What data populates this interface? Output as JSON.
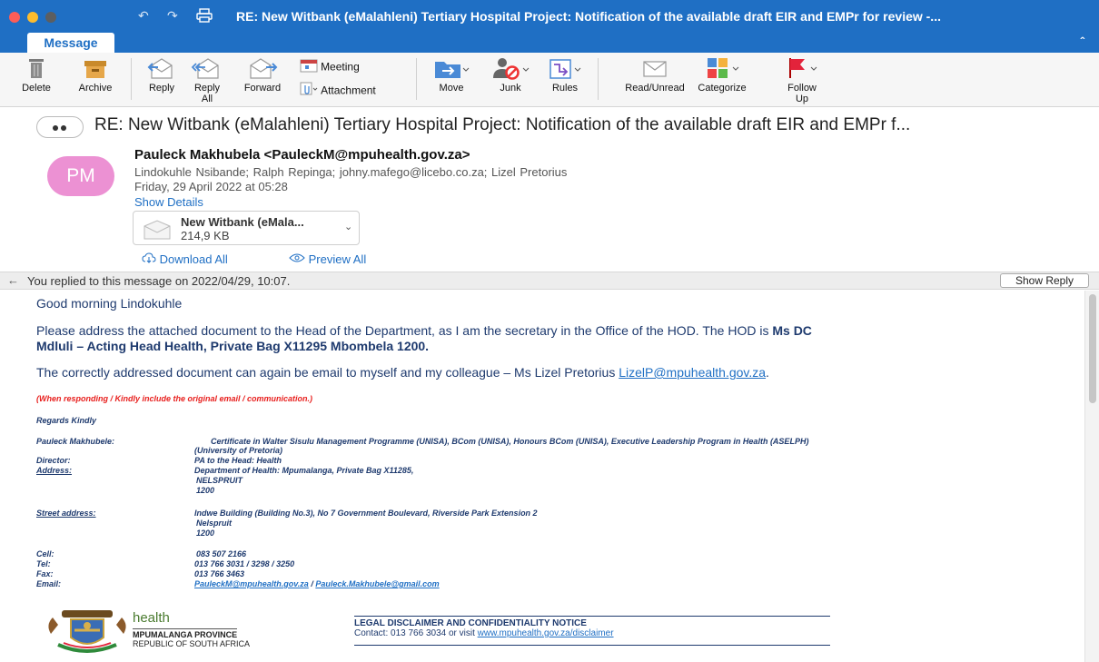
{
  "window": {
    "title": "RE: New Witbank (eMalahleni) Tertiary Hospital Project: Notification of the available draft EIR and EMPr for review -..."
  },
  "ribbon": {
    "tab": "Message",
    "buttons": {
      "delete": "Delete",
      "archive": "Archive",
      "reply": "Reply",
      "reply_all_1": "Reply",
      "reply_all_2": "All",
      "forward": "Forward",
      "meeting": "Meeting",
      "attachment": "Attachment",
      "move": "Move",
      "junk": "Junk",
      "rules": "Rules",
      "read_unread": "Read/Unread",
      "categorize": "Categorize",
      "follow_up_1": "Follow",
      "follow_up_2": "Up"
    }
  },
  "message": {
    "subject": "RE: New Witbank (eMalahleni) Tertiary Hospital Project: Notification of the available draft EIR and EMPr f...",
    "avatar_initials": "PM",
    "sender": "Pauleck Makhubela <PauleckM@mpuhealth.gov.za>",
    "recipients": "Lindokuhle Nsibande;  Ralph Repinga;  johny.mafego@licebo.co.za;  Lizel Pretorius",
    "date": "Friday, 29 April 2022 at 05:28",
    "show_details": "Show Details",
    "attachment": {
      "name": "New Witbank (eMala...",
      "size": "214,9 KB"
    },
    "download_all": "Download All",
    "preview_all": "Preview All",
    "replied_notice": "You replied to this message on 2022/04/29, 10:07.",
    "show_reply": "Show Reply"
  },
  "body": {
    "greeting": "Good morning Lindokuhle",
    "para1_a": "Please address the attached document to the Head of the Department, as I am the secretary in the Office of the HOD.  The HOD is ",
    "para1_b": "Ms DC",
    "para1_c": "Mdluli – Acting Head Health, Private Bag X11295 Mbombela 1200.",
    "para2_text": "The correctly addressed document can again be email to myself and my colleague – Ms Lizel Pretorius ",
    "para2_link": "LizelP@mpuhealth.gov.za",
    "para2_end": ".",
    "red_note": "(When responding / Kindly include the original email / communication.)",
    "regards": "Regards Kindly",
    "sig": {
      "name_label": "Pauleck Makhubele:",
      "name_value_1": "Certificate in Walter Sisulu Management Programme (UNISA), BCom (UNISA), Honours BCom (UNISA), Executive Leadership Program in Health (ASELPH)",
      "name_value_2": "(University of Pretoria)",
      "director_label": "Director:",
      "director_value": "PA to the Head: Health",
      "address_label": "Address:",
      "address_1": "Department of Health:  Mpumalanga, Private Bag X11285,",
      "address_2": "NELSPRUIT",
      "address_3": "1200",
      "street_label": "Street address:",
      "street_1": "Indwe Building (Building No.3), No 7 Government Boulevard, Riverside Park Extension 2",
      "street_2": "Nelspruit",
      "street_3": "1200",
      "cell_label": "Cell:",
      "cell_value": "083 507 2166",
      "tel_label": "Tel:",
      "tel_value": "013 766 3031 / 3298 / 3250",
      "fax_label": "Fax:",
      "fax_value": "013 766 3463",
      "email_label": "Email:",
      "email_1": "PauleckM@mpuhealth.gov.za",
      "email_sep": " / ",
      "email_2": "Pauleck.Makhubele@gmail.com"
    },
    "logo": {
      "health": "health",
      "province": "MPUMALANGA PROVINCE",
      "republic": "REPUBLIC OF SOUTH AFRICA"
    },
    "disclaimer": {
      "title": "LEGAL DISCLAIMER AND CONFIDENTIALITY NOTICE",
      "contact": "Contact: 013 766 3034 or visit ",
      "link": "www.mpuhealth.gov.za/disclaimer"
    }
  },
  "colors": {
    "title_bar": "#1f6fc4",
    "avatar": "#ec91d3",
    "link": "#1f6fc4",
    "body_text": "#1e3a6e",
    "warning": "#e8201e"
  }
}
